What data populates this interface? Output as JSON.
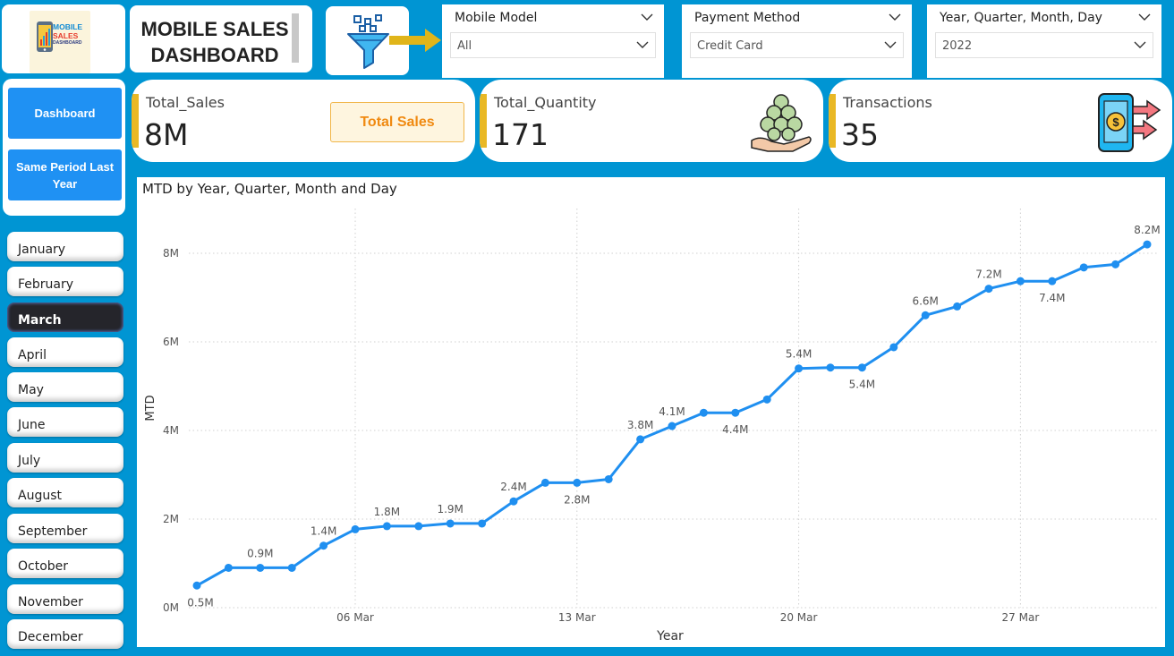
{
  "logo": {
    "line1": "MOBILE",
    "line2": "SALES",
    "line3": "DASHBOARD"
  },
  "title": {
    "line1": "MOBILE SALES",
    "line2": "DASHBOARD"
  },
  "slicers": {
    "model": {
      "title": "Mobile Model",
      "value": "All"
    },
    "payment": {
      "title": "Payment Method",
      "value": "Credit Card"
    },
    "date": {
      "title": "Year, Quarter, Month, Day",
      "value": "2022"
    }
  },
  "nav": {
    "dashboard": "Dashboard",
    "same_period": "Same Period Last Year"
  },
  "months": [
    "January",
    "February",
    "March",
    "April",
    "May",
    "June",
    "July",
    "August",
    "September",
    "October",
    "November",
    "December"
  ],
  "active_month": "March",
  "kpis": {
    "sales": {
      "label": "Total_Sales",
      "value": "8M",
      "button": "Total Sales"
    },
    "quantity": {
      "label": "Total_Quantity",
      "value": "171"
    },
    "transactions": {
      "label": "Transactions",
      "value": "35"
    }
  },
  "colors": {
    "background": "#0095d3",
    "accent": "#e9b825",
    "line": "#1f8ff0",
    "button": "#1f91f3"
  },
  "chart_data": {
    "type": "line",
    "title": "MTD by Year, Quarter, Month and Day",
    "xlabel": "Year",
    "ylabel": "MTD",
    "x_ticks": [
      "06 Mar",
      "13 Mar",
      "20 Mar",
      "27 Mar"
    ],
    "y_ticks": [
      "0M",
      "2M",
      "4M",
      "6M",
      "8M"
    ],
    "ylim": [
      0,
      9
    ],
    "grid": true,
    "x": [
      1,
      2,
      3,
      4,
      5,
      6,
      7,
      8,
      9,
      10,
      11,
      12,
      13,
      14,
      15,
      16,
      17,
      18,
      19,
      20,
      21,
      22,
      23,
      24,
      25,
      26,
      27,
      28,
      29,
      30,
      31
    ],
    "values": [
      0.5,
      0.9,
      0.9,
      0.9,
      1.4,
      1.77,
      1.84,
      1.84,
      1.9,
      1.9,
      2.4,
      2.82,
      2.82,
      2.9,
      3.8,
      4.1,
      4.4,
      4.4,
      4.7,
      5.4,
      5.42,
      5.42,
      5.88,
      6.6,
      6.8,
      7.2,
      7.37,
      7.37,
      7.68,
      7.75,
      8.2
    ],
    "data_labels": [
      {
        "x": 1,
        "text": "0.5M",
        "pos": "below"
      },
      {
        "x": 3,
        "text": "0.9M",
        "pos": "above"
      },
      {
        "x": 5,
        "text": "1.4M",
        "pos": "above"
      },
      {
        "x": 7,
        "text": "1.8M",
        "pos": "above"
      },
      {
        "x": 9,
        "text": "1.9M",
        "pos": "above"
      },
      {
        "x": 11,
        "text": "2.4M",
        "pos": "above"
      },
      {
        "x": 13,
        "text": "2.8M",
        "pos": "below"
      },
      {
        "x": 15,
        "text": "3.8M",
        "pos": "above"
      },
      {
        "x": 16,
        "text": "4.1M",
        "pos": "above"
      },
      {
        "x": 18,
        "text": "4.4M",
        "pos": "below"
      },
      {
        "x": 20,
        "text": "5.4M",
        "pos": "above"
      },
      {
        "x": 22,
        "text": "5.4M",
        "pos": "below"
      },
      {
        "x": 24,
        "text": "6.6M",
        "pos": "above"
      },
      {
        "x": 26,
        "text": "7.2M",
        "pos": "above"
      },
      {
        "x": 28,
        "text": "7.4M",
        "pos": "below"
      },
      {
        "x": 31,
        "text": "8.2M",
        "pos": "above"
      }
    ]
  }
}
